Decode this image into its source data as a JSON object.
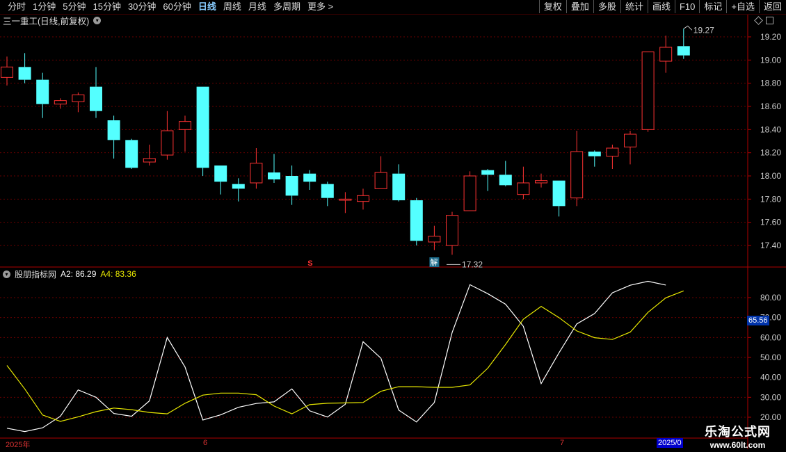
{
  "toolbar": {
    "periods": [
      "分时",
      "1分钟",
      "5分钟",
      "15分钟",
      "30分钟",
      "60分钟",
      "日线",
      "周线",
      "月线",
      "多周期",
      "更多 >"
    ],
    "active_index": 6,
    "right": [
      "复权",
      "叠加",
      "多股",
      "统计",
      "画线",
      "F10",
      "标记",
      "+自选",
      "返回"
    ]
  },
  "main_title": "三一重工(日线,前复权)",
  "indicator": {
    "name": "股朋指标网",
    "a2_label": "A2: 86.29",
    "a4_label": "A4: 83.36",
    "colors": {
      "a2": "#ffffff",
      "a4": "#e8e800"
    }
  },
  "markers": {
    "high_label": "19.27",
    "low_label": "17.32",
    "s_marker": "S",
    "jie_marker": "解"
  },
  "current_value_box": "65.56",
  "date_labels": {
    "left": "2025年",
    "mid1": "6",
    "mid2": "7",
    "box": "2025/0"
  },
  "watermark": {
    "line1": "乐淘公式网",
    "line2": "www.60lt.com"
  },
  "chart_data": [
    {
      "type": "candlestick",
      "ylim": [
        17.3,
        19.3
      ],
      "y_ticks": [
        "19.20",
        "19.00",
        "18.80",
        "18.60",
        "18.40",
        "18.20",
        "18.00",
        "17.80",
        "17.60",
        "17.40"
      ],
      "up_color": "#ff3333",
      "down_color": "#54ffff",
      "candles": [
        {
          "o": 18.85,
          "h": 19.03,
          "l": 18.78,
          "c": 18.94
        },
        {
          "o": 18.94,
          "h": 19.06,
          "l": 18.8,
          "c": 18.83
        },
        {
          "o": 18.83,
          "h": 18.89,
          "l": 18.5,
          "c": 18.62
        },
        {
          "o": 18.62,
          "h": 18.67,
          "l": 18.58,
          "c": 18.65
        },
        {
          "o": 18.64,
          "h": 18.72,
          "l": 18.55,
          "c": 18.7
        },
        {
          "o": 18.77,
          "h": 18.94,
          "l": 18.5,
          "c": 18.56
        },
        {
          "o": 18.48,
          "h": 18.52,
          "l": 18.15,
          "c": 18.31
        },
        {
          "o": 18.31,
          "h": 18.32,
          "l": 18.06,
          "c": 18.07
        },
        {
          "o": 18.12,
          "h": 18.27,
          "l": 18.09,
          "c": 18.15
        },
        {
          "o": 18.18,
          "h": 18.56,
          "l": 18.14,
          "c": 18.39
        },
        {
          "o": 18.4,
          "h": 18.52,
          "l": 18.21,
          "c": 18.47
        },
        {
          "o": 18.77,
          "h": 18.77,
          "l": 18.0,
          "c": 18.07
        },
        {
          "o": 18.09,
          "h": 18.09,
          "l": 17.84,
          "c": 17.95
        },
        {
          "o": 17.93,
          "h": 17.98,
          "l": 17.78,
          "c": 17.89
        },
        {
          "o": 17.94,
          "h": 18.24,
          "l": 17.89,
          "c": 18.11
        },
        {
          "o": 18.03,
          "h": 18.19,
          "l": 17.94,
          "c": 17.97
        },
        {
          "o": 18.0,
          "h": 18.09,
          "l": 17.75,
          "c": 17.83
        },
        {
          "o": 18.02,
          "h": 18.05,
          "l": 17.88,
          "c": 17.95
        },
        {
          "o": 17.93,
          "h": 17.95,
          "l": 17.74,
          "c": 17.81
        },
        {
          "o": 17.79,
          "h": 17.86,
          "l": 17.68,
          "c": 17.8
        },
        {
          "o": 17.78,
          "h": 17.89,
          "l": 17.71,
          "c": 17.83
        },
        {
          "o": 17.89,
          "h": 18.17,
          "l": 17.89,
          "c": 18.03
        },
        {
          "o": 18.02,
          "h": 18.1,
          "l": 17.78,
          "c": 17.79
        },
        {
          "o": 17.79,
          "h": 17.81,
          "l": 17.4,
          "c": 17.44
        },
        {
          "o": 17.43,
          "h": 17.57,
          "l": 17.36,
          "c": 17.48
        },
        {
          "o": 17.4,
          "h": 17.69,
          "l": 17.32,
          "c": 17.66
        },
        {
          "o": 17.7,
          "h": 18.04,
          "l": 17.7,
          "c": 18.0
        },
        {
          "o": 18.05,
          "h": 18.06,
          "l": 17.87,
          "c": 18.01
        },
        {
          "o": 18.01,
          "h": 18.13,
          "l": 17.91,
          "c": 17.92
        },
        {
          "o": 17.84,
          "h": 18.08,
          "l": 17.8,
          "c": 17.94
        },
        {
          "o": 17.94,
          "h": 18.02,
          "l": 17.9,
          "c": 17.96
        },
        {
          "o": 17.96,
          "h": 17.96,
          "l": 17.65,
          "c": 17.74
        },
        {
          "o": 17.81,
          "h": 18.39,
          "l": 17.74,
          "c": 18.21
        },
        {
          "o": 18.21,
          "h": 18.22,
          "l": 18.08,
          "c": 18.17
        },
        {
          "o": 18.17,
          "h": 18.27,
          "l": 18.06,
          "c": 18.24
        },
        {
          "o": 18.25,
          "h": 18.39,
          "l": 18.1,
          "c": 18.36
        },
        {
          "o": 18.4,
          "h": 19.07,
          "l": 18.38,
          "c": 19.07
        },
        {
          "o": 18.99,
          "h": 19.21,
          "l": 18.89,
          "c": 19.11
        },
        {
          "o": 19.12,
          "h": 19.27,
          "l": 19.01,
          "c": 19.04
        }
      ]
    },
    {
      "type": "line",
      "ylim": [
        18,
        92
      ],
      "y_ticks": [
        "80.00",
        "70.00",
        "60.00",
        "50.00",
        "40.00",
        "30.00",
        "20.00"
      ],
      "series": [
        {
          "name": "A2",
          "color": "#ffffff",
          "values": [
            14.5,
            12.8,
            14.7,
            20.5,
            33.7,
            30.0,
            21.9,
            20.5,
            28.2,
            60.0,
            45.2,
            18.6,
            21.2,
            25.0,
            26.9,
            27.7,
            34.2,
            23.2,
            20.1,
            26.5,
            57.9,
            49.6,
            23.6,
            17.6,
            27.4,
            62.5,
            86.5,
            82.0,
            76.7,
            65.6,
            36.9,
            52.3,
            66.8,
            72.0,
            82.4,
            86.2,
            88.2,
            86.3
          ]
        },
        {
          "name": "A4",
          "color": "#e8e800",
          "values": [
            46.0,
            34.2,
            21.1,
            17.9,
            20.2,
            22.8,
            24.6,
            23.8,
            22.4,
            21.7,
            27.0,
            31.1,
            32.1,
            32.1,
            31.3,
            25.6,
            21.7,
            26.3,
            27.0,
            27.2,
            27.4,
            33.0,
            35.3,
            35.3,
            35.0,
            35.0,
            36.2,
            44.6,
            56.5,
            69.2,
            75.6,
            70.0,
            63.3,
            59.9,
            59.0,
            62.7,
            72.6,
            79.9,
            83.4
          ]
        }
      ]
    }
  ]
}
